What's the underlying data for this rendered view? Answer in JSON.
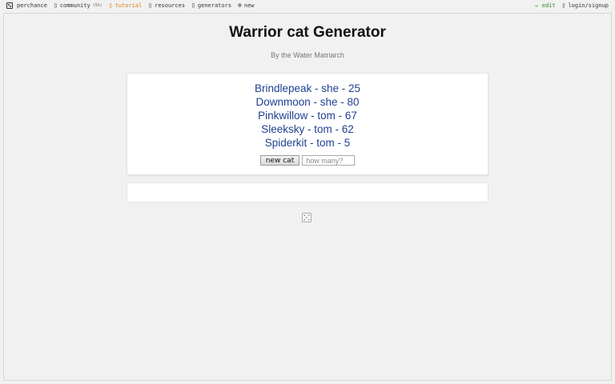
{
  "nav": {
    "logo_label": "perchance",
    "community_label": "community",
    "community_count": "(5h)",
    "tutorial_label": "tutorial",
    "resources_label": "resources",
    "generators_label": "generators",
    "new_label": "new",
    "edit_label": "edit",
    "login_label": "login/signup"
  },
  "icons": {
    "logo": "dice-icon",
    "community": "chat-icon",
    "tutorial": "book-icon",
    "resources": "book-icon",
    "generators": "list-icon",
    "new": "plus-circle-icon",
    "edit": "pencil-icon",
    "login": "user-icon",
    "footer": "dice-icon"
  },
  "page": {
    "title": "Warrior cat Generator",
    "subtitle": "By the Water Matriarch"
  },
  "results": [
    "Brindlepeak - she - 25",
    "Downmoon - she - 80",
    "Pinkwillow - tom - 67",
    "Sleeksky - tom - 62",
    "Spiderkit - tom - 5"
  ],
  "controls": {
    "button_label": "new cat",
    "input_placeholder": "how many?",
    "input_value": ""
  },
  "colors": {
    "accent_tutorial": "#e07a1a",
    "edit_green": "#2a8a2a",
    "result_blue": "#1f3f92"
  }
}
